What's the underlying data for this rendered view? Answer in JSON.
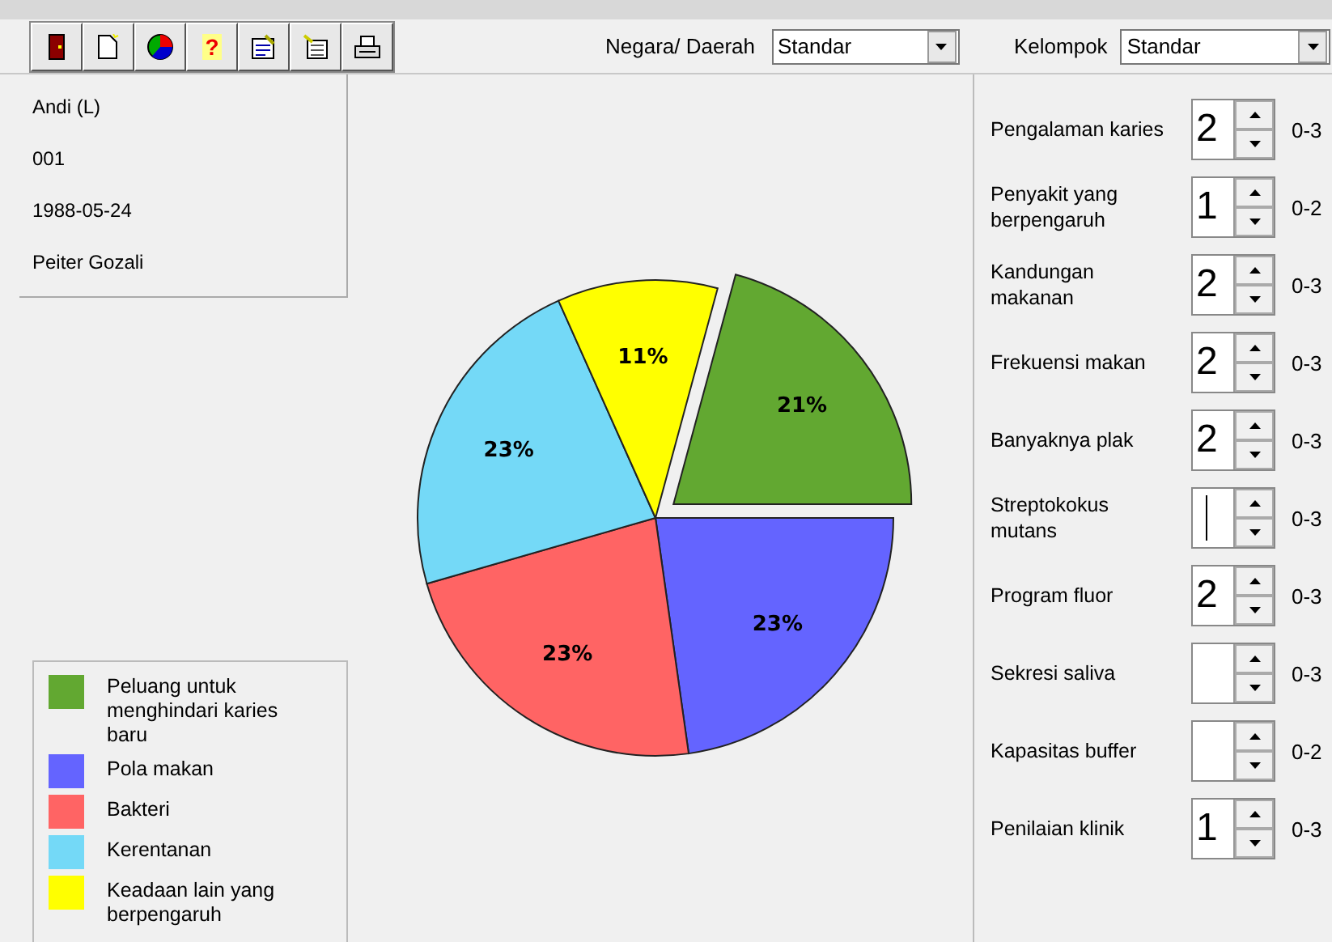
{
  "toolbar": {
    "help_glyph": "?",
    "filters": [
      {
        "label": "Negara/ Daerah",
        "value": "Standar"
      },
      {
        "label": "Kelompok",
        "value": "Standar"
      }
    ]
  },
  "patient": [
    "Andi (L)",
    "001",
    "1988-05-24",
    "Peiter Gozali"
  ],
  "chart_data": {
    "type": "pie",
    "categories": [
      "Peluang  untuk menghindari karies baru",
      "Pola makan",
      "Bakteri",
      "Kerentanan",
      "Keadaan lain yang berpengaruh"
    ],
    "series": [
      {
        "values": [
          21,
          23,
          23,
          23,
          11
        ]
      }
    ],
    "value_labels": [
      "21%",
      "23%",
      "23%",
      "23%",
      "11%"
    ]
  },
  "legend": [
    {
      "color": "#62a831"
    },
    {
      "color": "#6464ff"
    },
    {
      "color": "#ff6464"
    },
    {
      "color": "#74d9f7"
    },
    {
      "color": "#ffff00"
    }
  ],
  "factors": [
    {
      "label": "Pengalaman karies",
      "value": "2",
      "range": "0-3",
      "focused": false
    },
    {
      "label": "Penyakit yang berpengaruh",
      "value": "1",
      "range": "0-2",
      "focused": false
    },
    {
      "label": "Kandungan makanan",
      "value": "2",
      "range": "0-3",
      "focused": false
    },
    {
      "label": "Frekuensi makan",
      "value": "2",
      "range": "0-3",
      "focused": false
    },
    {
      "label": "Banyaknya plak",
      "value": "2",
      "range": "0-3",
      "focused": false
    },
    {
      "label": "Streptokokus mutans",
      "range": "0-3",
      "focused": true
    },
    {
      "label": "Program fluor",
      "value": "2",
      "range": "0-3",
      "focused": false
    },
    {
      "label": "Sekresi saliva",
      "range": "0-3",
      "focused": false
    },
    {
      "label": "Kapasitas buffer",
      "range": "0-2",
      "focused": false
    },
    {
      "label": "Penilaian klinik",
      "value": "1",
      "range": "0-3",
      "focused": false
    }
  ]
}
